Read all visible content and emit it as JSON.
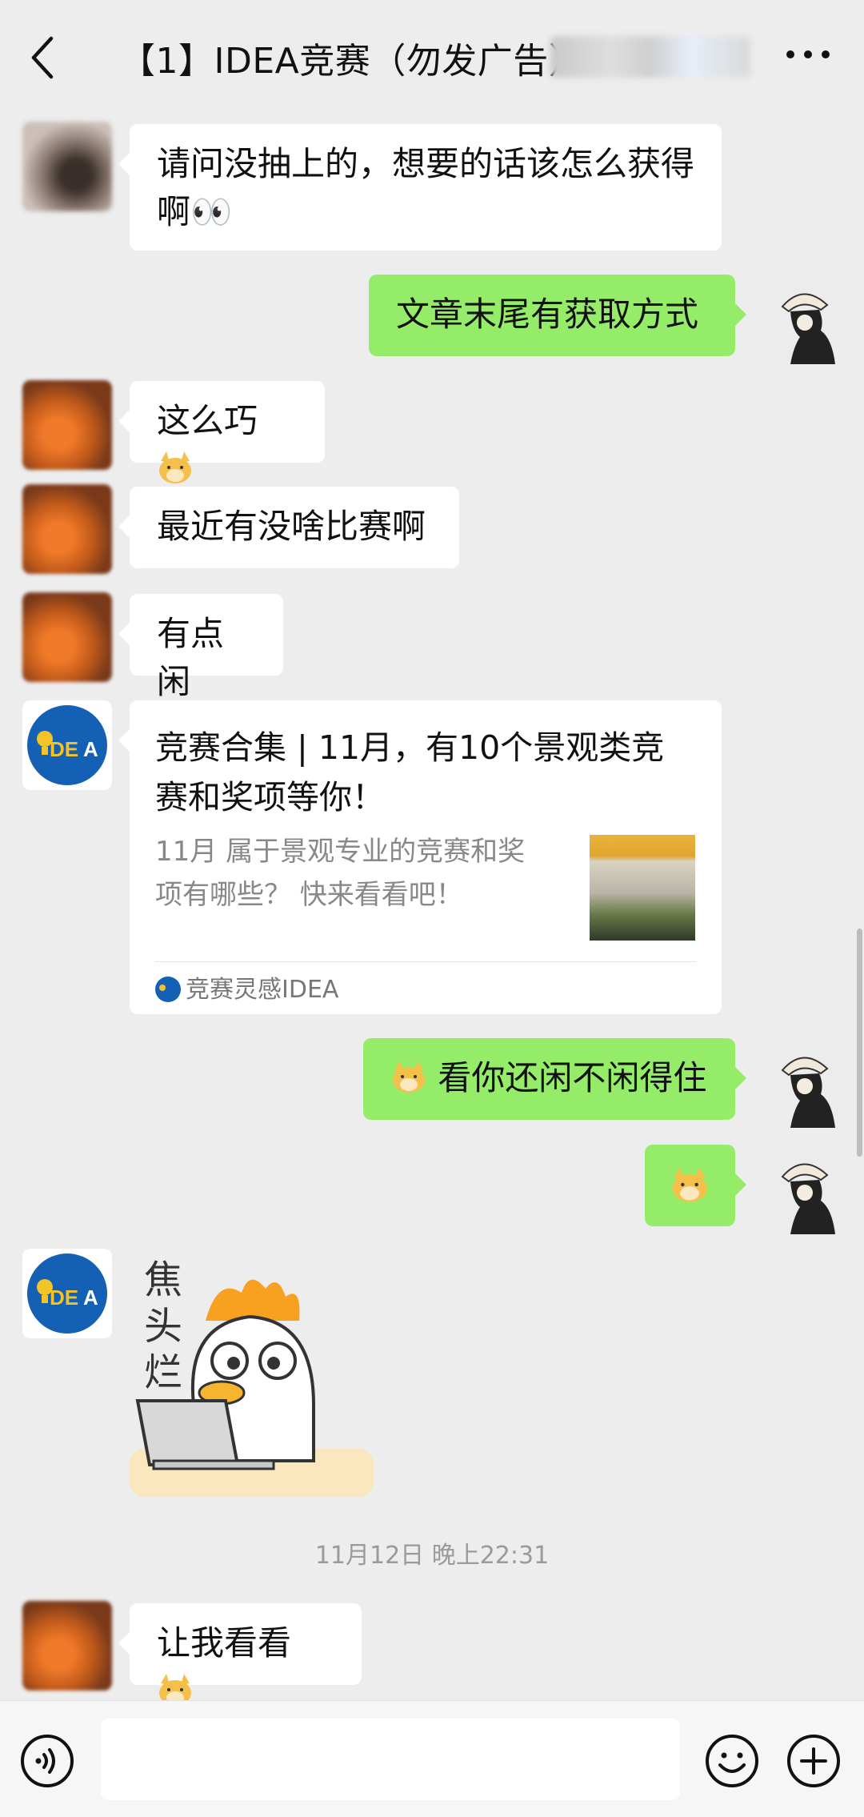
{
  "header": {
    "title": "【1】IDEA竞赛（勿发广告）"
  },
  "messages": {
    "m1": {
      "text": "请问没抽上的，想要的话该怎么获得啊👀"
    },
    "m2": {
      "text": "文章末尾有获取方式"
    },
    "m3": {
      "text": "这么巧"
    },
    "m4": {
      "text": "最近有没啥比赛啊"
    },
    "m5": {
      "text": "有点闲"
    },
    "m7": {
      "text": "看你还闲不闲得住"
    },
    "m11": {
      "text": "让我看看"
    }
  },
  "card": {
    "title": "竞赛合集 | 11月，有10个景观类竞赛和奖项等你！",
    "description": "11月 属于景观专业的竞赛和奖项有哪些？ 快来看看吧！",
    "source": "竞赛灵感IDEA",
    "logo_text": "IDEA"
  },
  "sticker": {
    "caption": "焦头烂额"
  },
  "timestamp": "11月12日 晚上22:31",
  "colors": {
    "background": "#ededed",
    "self_bubble": "#95ec69",
    "other_bubble": "#ffffff",
    "idea_blue": "#1460b5",
    "idea_yellow": "#f4c325"
  },
  "icons": {
    "back": "back-arrow-icon",
    "more": "more-dots-icon",
    "voice": "voice-icon",
    "emoji": "emoji-icon",
    "plus": "plus-icon"
  }
}
